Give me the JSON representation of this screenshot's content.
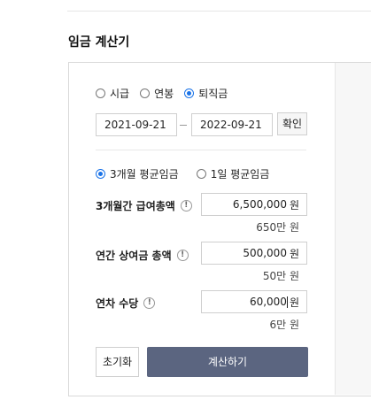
{
  "title": "임금 계산기",
  "period_options": [
    {
      "label": "시급",
      "checked": false
    },
    {
      "label": "연봉",
      "checked": false
    },
    {
      "label": "퇴직금",
      "checked": true
    }
  ],
  "dates": {
    "start": "2021-09-21",
    "end": "2022-09-21",
    "confirm_label": "확인"
  },
  "avg_options": [
    {
      "label": "3개월 평균임금",
      "checked": true
    },
    {
      "label": "1일 평균임금",
      "checked": false
    }
  ],
  "fields": [
    {
      "label": "3개월간 급여총액",
      "value": "6,500,000",
      "unit": "원",
      "sub": "650만 원"
    },
    {
      "label": "연간 상여금 총액",
      "value": "500,000",
      "unit": "원",
      "sub": "50만 원"
    },
    {
      "label": "연차 수당",
      "value": "60,000",
      "unit": "원",
      "sub": "6만 원"
    }
  ],
  "info_icon": "!",
  "buttons": {
    "reset_label": "초기화",
    "calculate_label": "계산하기"
  },
  "colors": {
    "accent": "#1a73e8",
    "calc_button": "#5b6580"
  }
}
